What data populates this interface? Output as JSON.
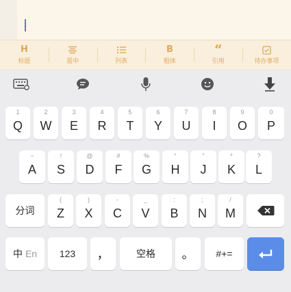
{
  "format_toolbar": {
    "items": [
      {
        "icon_text": "H",
        "label": "标题"
      },
      {
        "icon": "align-center-icon",
        "label": "居中"
      },
      {
        "icon": "list-icon",
        "label": "列表"
      },
      {
        "icon_text": "B",
        "label": "粗体"
      },
      {
        "icon_text": "“",
        "label": "引用"
      },
      {
        "icon": "checkbox-icon",
        "label": "待办事项"
      }
    ]
  },
  "keyboard": {
    "tools": [
      "keyboard-settings-icon",
      "chat-bubble-icon",
      "microphone-icon",
      "emoji-icon",
      "hide-keyboard-icon"
    ],
    "row1": [
      {
        "hint": "1",
        "key": "Q"
      },
      {
        "hint": "2",
        "key": "W"
      },
      {
        "hint": "3",
        "key": "E"
      },
      {
        "hint": "4",
        "key": "R"
      },
      {
        "hint": "5",
        "key": "T"
      },
      {
        "hint": "6",
        "key": "Y"
      },
      {
        "hint": "7",
        "key": "U"
      },
      {
        "hint": "8",
        "key": "I"
      },
      {
        "hint": "9",
        "key": "O"
      },
      {
        "hint": "0",
        "key": "P"
      }
    ],
    "row2": [
      {
        "hint": "~",
        "key": "A"
      },
      {
        "hint": "!",
        "key": "S"
      },
      {
        "hint": "@",
        "key": "D"
      },
      {
        "hint": "#",
        "key": "F"
      },
      {
        "hint": "%",
        "key": "G"
      },
      {
        "hint": "“",
        "key": "H"
      },
      {
        "hint": "”",
        "key": "J"
      },
      {
        "hint": "*",
        "key": "K"
      },
      {
        "hint": "?",
        "key": "L"
      }
    ],
    "row3": {
      "fenci": "分词",
      "letters": [
        {
          "hint": "(",
          "key": "Z"
        },
        {
          "hint": ")",
          "key": "X"
        },
        {
          "hint": "-",
          "key": "C"
        },
        {
          "hint": "_",
          "key": "V"
        },
        {
          "hint": ":",
          "key": "B"
        },
        {
          "hint": ";",
          "key": "N"
        },
        {
          "hint": "/",
          "key": "M"
        }
      ]
    },
    "row4": {
      "lang_cn": "中",
      "lang_en": "En",
      "numbers": "123",
      "comma": "，",
      "space": "空格",
      "period": "。",
      "symbols": "#+="
    },
    "colors": {
      "accent": "#5b8de8",
      "toolbar_text": "#e0a85a"
    }
  }
}
